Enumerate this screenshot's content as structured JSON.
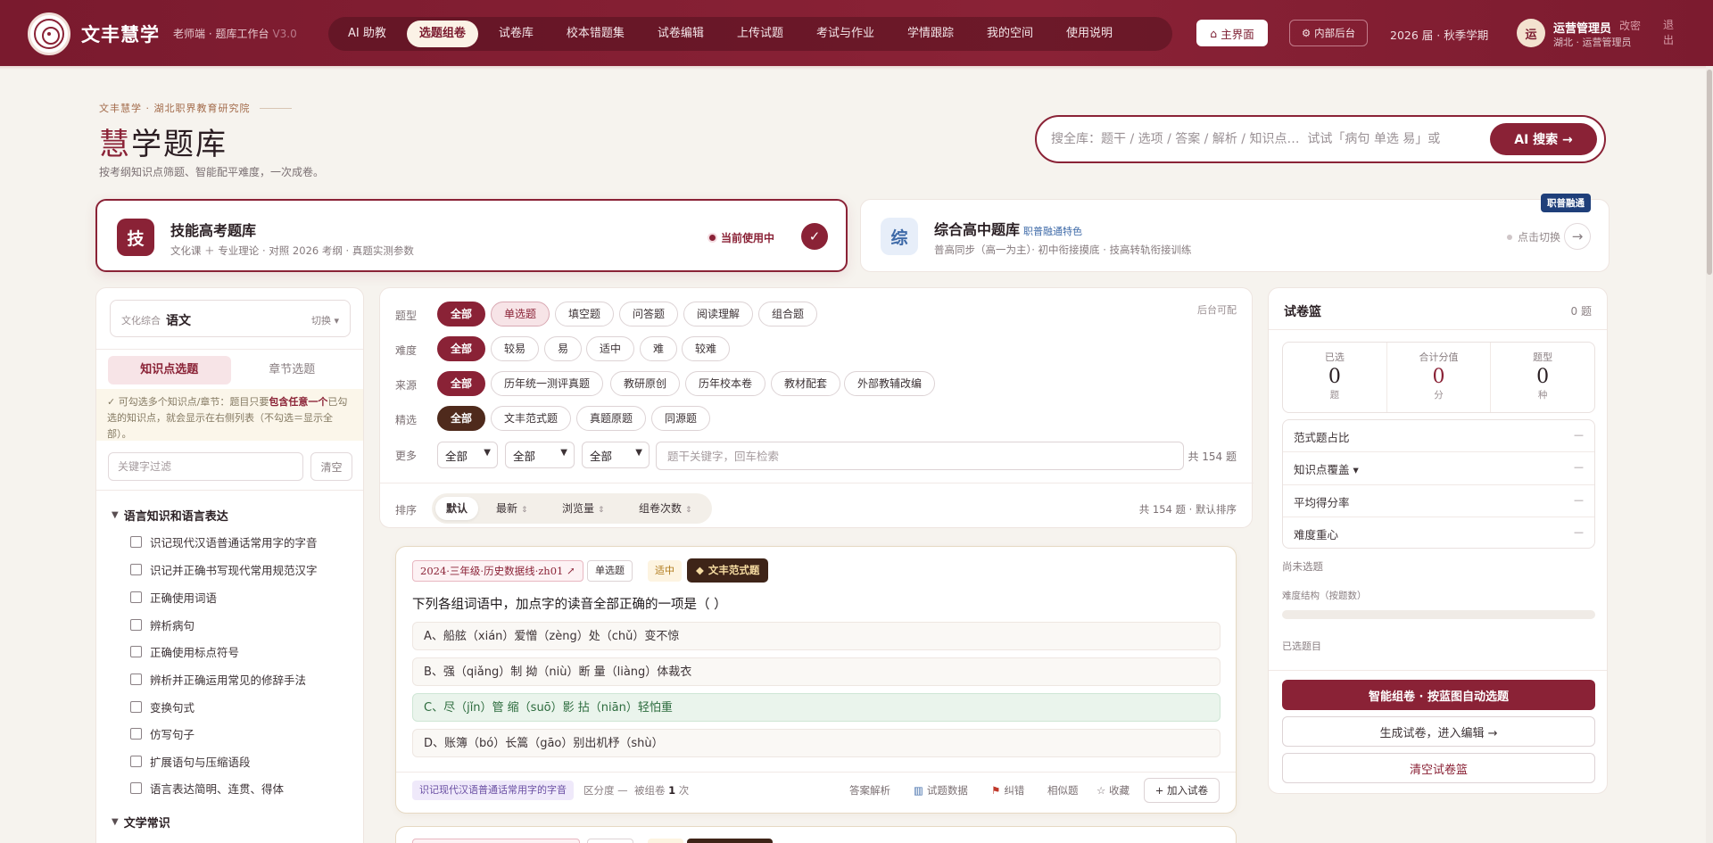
{
  "app": {
    "brand": "文丰慧学",
    "brand_sub": "老师端 · 题库工作台",
    "version": "V3.0"
  },
  "nav": {
    "items": [
      "AI 助教",
      "选题组卷",
      "试卷库",
      "校本错题集",
      "试卷编辑",
      "上传试题",
      "考试与作业",
      "学情跟踪",
      "我的空间",
      "使用说明"
    ],
    "active_index": 1,
    "home_label": "主界面",
    "backend_label": "内部后台",
    "term": "2026 届 · 秋季学期"
  },
  "user": {
    "avatar": "运",
    "name": "运营管理员",
    "region": "湖北 · 运营管理员",
    "edit": "改密",
    "logout": "退出"
  },
  "header": {
    "eyebrow": "文丰慧学 · 湖北职界教育研究院",
    "title_hl": "慧",
    "title_rest": "学题库",
    "subtitle": "按考纲知识点筛题、智能配平难度，一次成卷。"
  },
  "search": {
    "placeholder": "搜全库：题干 / 选项 / 答案 / 解析 / 知识点…  试试「病句 单选 易」或",
    "button": "AI 搜索 →"
  },
  "banks": {
    "active": {
      "icon": "技",
      "name": "技能高考题库",
      "desc": "文化课 ＋ 专业理论 · 对照 2026 考纲 · 真题实测参数",
      "status": "当前使用中"
    },
    "alt": {
      "icon": "综",
      "name": "综合高中题库",
      "tag": "职普融通特色",
      "desc": "普高同步（高一为主）· 初中衔接摸底 · 技高转轨衔接训练",
      "status": "点击切换",
      "ribbon": "职普融通"
    }
  },
  "sidebar": {
    "subject_label": "文化综合",
    "subject_value": "语文",
    "subject_switch": "切换 ▾",
    "tabs": [
      "知识点选题",
      "章节选题"
    ],
    "hint_pre": "✓ 可勾选多个知识点/章节：题目只要",
    "hint_bold": "包含任意一个",
    "hint_post": "已勾选的知识点，就会显示在右侧列表（不勾选＝显示全部）。",
    "filter_placeholder": "关键字过滤",
    "clear": "清空",
    "group1": "语言知识和语言表达",
    "items": [
      "识记现代汉语普通话常用字的字音",
      "识记并正确书写现代常用规范汉字",
      "正确使用词语",
      "辨析病句",
      "正确使用标点符号",
      "辨析并正确运用常见的修辞手法",
      "变换句式",
      "仿写句子",
      "扩展语句与压缩语段",
      "语言表达简明、连贯、得体"
    ],
    "group2": "文学常识"
  },
  "filters": {
    "labels": [
      "题型",
      "难度",
      "来源",
      "精选",
      "更多"
    ],
    "type": [
      "全部",
      "单选题",
      "填空题",
      "问答题",
      "阅读理解",
      "组合题"
    ],
    "difficulty": [
      "全部",
      "较易",
      "易",
      "适中",
      "难",
      "较难"
    ],
    "source": [
      "全部",
      "历年统一测评真题",
      "教研原创",
      "历年校本卷",
      "教材配套",
      "外部教辅改编"
    ],
    "featured": [
      "全部",
      "文丰范式题",
      "真题原题",
      "同源题"
    ],
    "more_selects": [
      "全部",
      "全部",
      "全部"
    ],
    "keyword_placeholder": "题干关键字，回车检索",
    "total": "共 154 题",
    "backend_note": "后台可配"
  },
  "sort": {
    "label": "排序",
    "options": [
      "默认",
      "最新",
      "浏览量",
      "组卷次数"
    ],
    "total": "共 154 题 · 默认排序"
  },
  "question": {
    "source": "2024·三年级·历史数据线·zh01 ↗",
    "type": "单选题",
    "difficulty": "适中",
    "model": "文丰范式题",
    "stem": "下列各组词语中，加点字的读音全部正确的一项是（ ）",
    "options": [
      "A、船舷（xián）爱憎（zèng）处（chǔ）变不惊",
      "B、强（qiǎng）制 拗（niù）断 量（liàng）体裁衣",
      "C、尽（jǐn）管 缩（suō）影 拈（niān）轻怕重",
      "D、账簿（bó）长篙（gāo）别出机杼（shù）"
    ],
    "correct_index": 2,
    "knowledge_point": "识记现代汉语普通话常用字的字音",
    "discrimination_label": "区分度 —",
    "used_pre": "被组卷",
    "used_count": "1",
    "used_post": "次",
    "actions": [
      "答案解析",
      "试题数据",
      "纠错",
      "相似题",
      "☆ 收藏"
    ],
    "add": "+ 加入试卷"
  },
  "basket": {
    "title": "试卷篮",
    "count": "0 题",
    "stats": [
      {
        "label": "已选",
        "value": "0",
        "unit": "题"
      },
      {
        "label": "合计分值",
        "value": "0",
        "unit": "分"
      },
      {
        "label": "题型",
        "value": "0",
        "unit": "种"
      }
    ],
    "metrics": [
      {
        "label": "范式题占比",
        "value": "—"
      },
      {
        "label": "知识点覆盖 ▾",
        "value": "—"
      },
      {
        "label": "平均得分率",
        "value": "—"
      },
      {
        "label": "难度重心",
        "value": "—"
      }
    ],
    "empty": "尚未选题",
    "structure": "难度结构（按题数）",
    "selected": "已选题目",
    "btn_auto": "智能组卷 · 按蓝图自动选题",
    "btn_generate": "生成试卷，进入编辑 →",
    "btn_clear": "清空试卷篮"
  },
  "colors": {
    "primary": "#8a2236",
    "nav_bg": "#7a1a2e",
    "accent_blue": "#1f3f7a",
    "correct_green": "#2c6b3d"
  }
}
